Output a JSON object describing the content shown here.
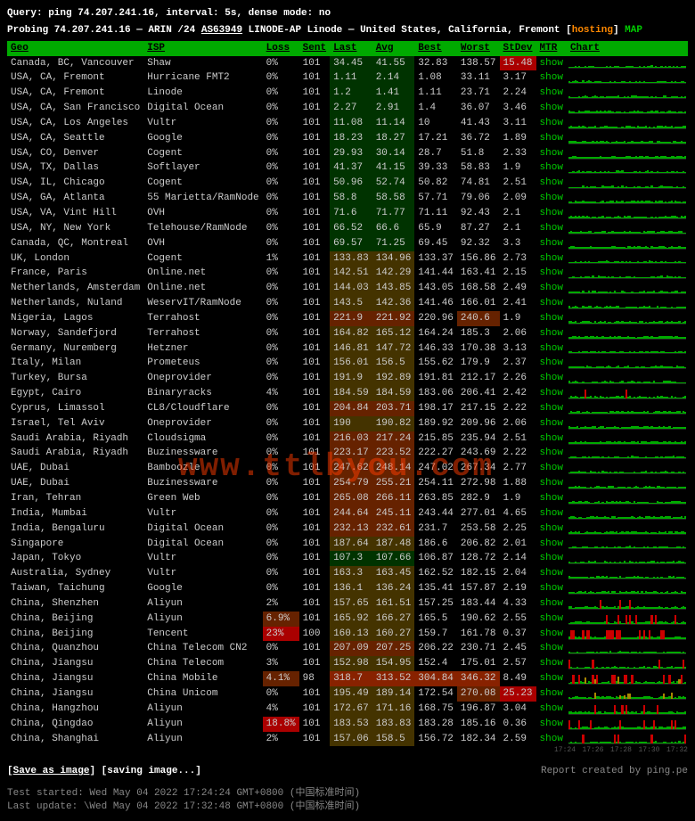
{
  "header": {
    "query_line": "Query: ping 74.207.241.16, interval: 5s, dense mode: no",
    "probe_prefix": "Probing 74.207.241.16 — ARIN /24 ",
    "asn": "AS63949",
    "probe_mid": " LINODE-AP Linode — United States, California, Fremont [",
    "hosting": "hosting",
    "probe_end": "] ",
    "map": "MAP"
  },
  "columns": [
    "Geo",
    "ISP",
    "Loss",
    "Sent",
    "Last",
    "Avg",
    "Best",
    "Worst",
    "StDev",
    "MTR",
    "Chart"
  ],
  "rows": [
    {
      "geo": "Canada, BC, Vancouver",
      "isp": "Shaw",
      "loss": "0%",
      "sent": "101",
      "last": "34.45",
      "avg": "41.55",
      "best": "32.83",
      "worst": "138.57",
      "stdev": "15.48",
      "lastcls": "bg-good",
      "stdevcls": "bg-crit",
      "chart": "g"
    },
    {
      "geo": "USA, CA, Fremont",
      "isp": "Hurricane FMT2",
      "loss": "0%",
      "sent": "101",
      "last": "1.11",
      "avg": "2.14",
      "best": "1.08",
      "worst": "33.11",
      "stdev": "3.17",
      "lastcls": "bg-good",
      "chart": "g"
    },
    {
      "geo": "USA, CA, Fremont",
      "isp": "Linode",
      "loss": "0%",
      "sent": "101",
      "last": "1.2",
      "avg": "1.41",
      "best": "1.11",
      "worst": "23.71",
      "stdev": "2.24",
      "lastcls": "bg-good",
      "chart": "g"
    },
    {
      "geo": "USA, CA, San Francisco",
      "isp": "Digital Ocean",
      "loss": "0%",
      "sent": "101",
      "last": "2.27",
      "avg": "2.91",
      "best": "1.4",
      "worst": "36.07",
      "stdev": "3.46",
      "lastcls": "bg-good",
      "chart": "g"
    },
    {
      "geo": "USA, CA, Los Angeles",
      "isp": "Vultr",
      "loss": "0%",
      "sent": "101",
      "last": "11.08",
      "avg": "11.14",
      "best": "10",
      "worst": "41.43",
      "stdev": "3.11",
      "lastcls": "bg-good",
      "chart": "g"
    },
    {
      "geo": "USA, CA, Seattle",
      "isp": "Google",
      "loss": "0%",
      "sent": "101",
      "last": "18.23",
      "avg": "18.27",
      "best": "17.21",
      "worst": "36.72",
      "stdev": "1.89",
      "lastcls": "bg-good",
      "chart": "g"
    },
    {
      "geo": "USA, CO, Denver",
      "isp": "Cogent",
      "loss": "0%",
      "sent": "101",
      "last": "29.93",
      "avg": "30.14",
      "best": "28.7",
      "worst": "51.8",
      "stdev": "2.33",
      "lastcls": "bg-good",
      "chart": "g"
    },
    {
      "geo": "USA, TX, Dallas",
      "isp": "Softlayer",
      "loss": "0%",
      "sent": "101",
      "last": "41.37",
      "avg": "41.15",
      "best": "39.33",
      "worst": "58.83",
      "stdev": "1.9",
      "lastcls": "bg-good",
      "chart": "g"
    },
    {
      "geo": "USA, IL, Chicago",
      "isp": "Cogent",
      "loss": "0%",
      "sent": "101",
      "last": "50.96",
      "avg": "52.74",
      "best": "50.82",
      "worst": "74.81",
      "stdev": "2.51",
      "lastcls": "bg-good",
      "chart": "g"
    },
    {
      "geo": "USA, GA, Atlanta",
      "isp": "55 Marietta/RamNode",
      "loss": "0%",
      "sent": "101",
      "last": "58.8",
      "avg": "58.58",
      "best": "57.71",
      "worst": "79.06",
      "stdev": "2.09",
      "lastcls": "bg-good",
      "chart": "g"
    },
    {
      "geo": "USA, VA, Vint Hill",
      "isp": "OVH",
      "loss": "0%",
      "sent": "101",
      "last": "71.6",
      "avg": "71.77",
      "best": "71.11",
      "worst": "92.43",
      "stdev": "2.1",
      "lastcls": "bg-good",
      "chart": "g"
    },
    {
      "geo": "USA, NY, New York",
      "isp": "Telehouse/RamNode",
      "loss": "0%",
      "sent": "101",
      "last": "66.52",
      "avg": "66.6",
      "best": "65.9",
      "worst": "87.27",
      "stdev": "2.1",
      "lastcls": "bg-good",
      "chart": "g"
    },
    {
      "geo": "Canada, QC, Montreal",
      "isp": "OVH",
      "loss": "0%",
      "sent": "101",
      "last": "69.57",
      "avg": "71.25",
      "best": "69.45",
      "worst": "92.32",
      "stdev": "3.3",
      "lastcls": "bg-good",
      "chart": "g"
    },
    {
      "geo": "UK, London",
      "isp": "Cogent",
      "loss": "1%",
      "sent": "101",
      "last": "133.83",
      "avg": "134.96",
      "best": "133.37",
      "worst": "156.86",
      "stdev": "2.73",
      "lastcls": "bg-med",
      "chart": "g"
    },
    {
      "geo": "France, Paris",
      "isp": "Online.net",
      "loss": "0%",
      "sent": "101",
      "last": "142.51",
      "avg": "142.29",
      "best": "141.44",
      "worst": "163.41",
      "stdev": "2.15",
      "lastcls": "bg-med",
      "chart": "g"
    },
    {
      "geo": "Netherlands, Amsterdam",
      "isp": "Online.net",
      "loss": "0%",
      "sent": "101",
      "last": "144.03",
      "avg": "143.85",
      "best": "143.05",
      "worst": "168.58",
      "stdev": "2.49",
      "lastcls": "bg-med",
      "chart": "g"
    },
    {
      "geo": "Netherlands, Nuland",
      "isp": "WeservIT/RamNode",
      "loss": "0%",
      "sent": "101",
      "last": "143.5",
      "avg": "142.36",
      "best": "141.46",
      "worst": "166.01",
      "stdev": "2.41",
      "lastcls": "bg-med",
      "chart": "g"
    },
    {
      "geo": "Nigeria, Lagos",
      "isp": "Terrahost",
      "loss": "0%",
      "sent": "101",
      "last": "221.9",
      "avg": "221.92",
      "best": "220.96",
      "worst": "240.6",
      "stdev": "1.9",
      "lastcls": "bg-bad",
      "worstcls": "bg-bad",
      "chart": "g"
    },
    {
      "geo": "Norway, Sandefjord",
      "isp": "Terrahost",
      "loss": "0%",
      "sent": "101",
      "last": "164.82",
      "avg": "165.12",
      "best": "164.24",
      "worst": "185.3",
      "stdev": "2.06",
      "lastcls": "bg-med",
      "chart": "g"
    },
    {
      "geo": "Germany, Nuremberg",
      "isp": "Hetzner",
      "loss": "0%",
      "sent": "101",
      "last": "146.81",
      "avg": "147.72",
      "best": "146.33",
      "worst": "170.38",
      "stdev": "3.13",
      "lastcls": "bg-med",
      "chart": "g"
    },
    {
      "geo": "Italy, Milan",
      "isp": "Prometeus",
      "loss": "0%",
      "sent": "101",
      "last": "156.01",
      "avg": "156.5",
      "best": "155.62",
      "worst": "179.9",
      "stdev": "2.37",
      "lastcls": "bg-med",
      "chart": "g"
    },
    {
      "geo": "Turkey, Bursa",
      "isp": "Oneprovider",
      "loss": "0%",
      "sent": "101",
      "last": "191.9",
      "avg": "192.89",
      "best": "191.81",
      "worst": "212.17",
      "stdev": "2.26",
      "lastcls": "bg-med",
      "chart": "g"
    },
    {
      "geo": "Egypt, Cairo",
      "isp": "Binaryracks",
      "loss": "4%",
      "sent": "101",
      "last": "184.59",
      "avg": "184.59",
      "best": "183.06",
      "worst": "206.41",
      "stdev": "2.42",
      "lastcls": "bg-med",
      "chart": "gr"
    },
    {
      "geo": "Cyprus, Limassol",
      "isp": "CL8/Cloudflare",
      "loss": "0%",
      "sent": "101",
      "last": "204.84",
      "avg": "203.71",
      "best": "198.17",
      "worst": "217.15",
      "stdev": "2.22",
      "lastcls": "bg-bad",
      "chart": "g"
    },
    {
      "geo": "Israel, Tel Aviv",
      "isp": "Oneprovider",
      "loss": "0%",
      "sent": "101",
      "last": "190",
      "avg": "190.82",
      "best": "189.92",
      "worst": "209.96",
      "stdev": "2.06",
      "lastcls": "bg-med",
      "chart": "g"
    },
    {
      "geo": "Saudi Arabia, Riyadh",
      "isp": "Cloudsigma",
      "loss": "0%",
      "sent": "101",
      "last": "216.03",
      "avg": "217.24",
      "best": "215.85",
      "worst": "235.94",
      "stdev": "2.51",
      "lastcls": "bg-bad",
      "chart": "g"
    },
    {
      "geo": "Saudi Arabia, Riyadh",
      "isp": "Buzinessware",
      "loss": "0%",
      "sent": "101",
      "last": "223.17",
      "avg": "223.52",
      "best": "222.27",
      "worst": "243.69",
      "stdev": "2.22",
      "lastcls": "bg-bad",
      "chart": "g"
    },
    {
      "geo": "UAE, Dubai",
      "isp": "Bamboozle",
      "loss": "0%",
      "sent": "101",
      "last": "247.62",
      "avg": "248.14",
      "best": "247.02",
      "worst": "267.34",
      "stdev": "2.77",
      "lastcls": "bg-bad",
      "chart": "g"
    },
    {
      "geo": "UAE, Dubai",
      "isp": "Buzinessware",
      "loss": "0%",
      "sent": "101",
      "last": "254.79",
      "avg": "255.21",
      "best": "254.11",
      "worst": "272.98",
      "stdev": "1.88",
      "lastcls": "bg-bad",
      "chart": "g"
    },
    {
      "geo": "Iran, Tehran",
      "isp": "Green Web",
      "loss": "0%",
      "sent": "101",
      "last": "265.08",
      "avg": "266.11",
      "best": "263.85",
      "worst": "282.9",
      "stdev": "1.9",
      "lastcls": "bg-bad",
      "chart": "g"
    },
    {
      "geo": "India, Mumbai",
      "isp": "Vultr",
      "loss": "0%",
      "sent": "101",
      "last": "244.64",
      "avg": "245.11",
      "best": "243.44",
      "worst": "277.01",
      "stdev": "4.65",
      "lastcls": "bg-bad",
      "chart": "g"
    },
    {
      "geo": "India, Bengaluru",
      "isp": "Digital Ocean",
      "loss": "0%",
      "sent": "101",
      "last": "232.13",
      "avg": "232.61",
      "best": "231.7",
      "worst": "253.58",
      "stdev": "2.25",
      "lastcls": "bg-bad",
      "chart": "g"
    },
    {
      "geo": "Singapore",
      "isp": "Digital Ocean",
      "loss": "0%",
      "sent": "101",
      "last": "187.64",
      "avg": "187.48",
      "best": "186.6",
      "worst": "206.82",
      "stdev": "2.01",
      "lastcls": "bg-med",
      "chart": "g"
    },
    {
      "geo": "Japan, Tokyo",
      "isp": "Vultr",
      "loss": "0%",
      "sent": "101",
      "last": "107.3",
      "avg": "107.66",
      "best": "106.87",
      "worst": "128.72",
      "stdev": "2.14",
      "lastcls": "bg-good",
      "chart": "g"
    },
    {
      "geo": "Australia, Sydney",
      "isp": "Vultr",
      "loss": "0%",
      "sent": "101",
      "last": "163.3",
      "avg": "163.45",
      "best": "162.52",
      "worst": "182.15",
      "stdev": "2.04",
      "lastcls": "bg-med",
      "chart": "g"
    },
    {
      "geo": "Taiwan, Taichung",
      "isp": "Google",
      "loss": "0%",
      "sent": "101",
      "last": "136.1",
      "avg": "136.24",
      "best": "135.41",
      "worst": "157.87",
      "stdev": "2.19",
      "lastcls": "bg-med",
      "chart": "g"
    },
    {
      "geo": "China, Shenzhen",
      "isp": "Aliyun",
      "loss": "2%",
      "sent": "101",
      "last": "157.65",
      "avg": "161.51",
      "best": "157.25",
      "worst": "183.44",
      "stdev": "4.33",
      "lastcls": "bg-med",
      "chart": "gr"
    },
    {
      "geo": "China, Beijing",
      "isp": "Aliyun",
      "loss": "6.9%",
      "sent": "101",
      "last": "165.92",
      "avg": "166.27",
      "best": "165.5",
      "worst": "190.62",
      "stdev": "2.55",
      "lastcls": "bg-med",
      "losscls": "bg-bad",
      "chart": "grr"
    },
    {
      "geo": "China, Beijing",
      "isp": "Tencent",
      "loss": "23%",
      "sent": "100",
      "last": "160.13",
      "avg": "160.27",
      "best": "159.7",
      "worst": "161.78",
      "stdev": "0.37",
      "lastcls": "bg-med",
      "losscls": "bg-crit",
      "chart": "grrr"
    },
    {
      "geo": "China, Quanzhou",
      "isp": "China Telecom CN2",
      "loss": "0%",
      "sent": "101",
      "last": "207.09",
      "avg": "207.25",
      "best": "206.22",
      "worst": "230.71",
      "stdev": "2.45",
      "lastcls": "bg-bad",
      "chart": "g"
    },
    {
      "geo": "China, Jiangsu",
      "isp": "China Telecom",
      "loss": "3%",
      "sent": "101",
      "last": "152.98",
      "avg": "154.95",
      "best": "152.4",
      "worst": "175.01",
      "stdev": "2.57",
      "lastcls": "bg-med",
      "chart": "gr"
    },
    {
      "geo": "China, Jiangsu",
      "isp": "China Mobile",
      "loss": "4.1%",
      "sent": "98",
      "last": "318.7",
      "avg": "313.52",
      "best": "304.84",
      "worst": "346.32",
      "stdev": "8.49",
      "lastcls": "bg-vbad",
      "avgcls": "bg-vbad",
      "bestcls": "bg-vbad",
      "worstcls": "bg-vbad",
      "losscls": "bg-bad",
      "chart": "yrr"
    },
    {
      "geo": "China, Jiangsu",
      "isp": "China Unicom",
      "loss": "0%",
      "sent": "101",
      "last": "195.49",
      "avg": "189.14",
      "best": "172.54",
      "worst": "270.08",
      "stdev": "25.23",
      "lastcls": "bg-med",
      "worstcls": "bg-bad",
      "stdevcls": "bg-crit",
      "chart": "gy"
    },
    {
      "geo": "China, Hangzhou",
      "isp": "Aliyun",
      "loss": "4%",
      "sent": "101",
      "last": "172.67",
      "avg": "171.16",
      "best": "168.75",
      "worst": "196.87",
      "stdev": "3.04",
      "lastcls": "bg-med",
      "chart": "gr"
    },
    {
      "geo": "China, Qingdao",
      "isp": "Aliyun",
      "loss": "18.8%",
      "sent": "101",
      "last": "183.53",
      "avg": "183.83",
      "best": "183.28",
      "worst": "185.16",
      "stdev": "0.36",
      "lastcls": "bg-med",
      "losscls": "bg-crit",
      "chart": "grrr"
    },
    {
      "geo": "China, Shanghai",
      "isp": "Aliyun",
      "loss": "2%",
      "sent": "101",
      "last": "157.06",
      "avg": "158.5",
      "best": "156.72",
      "worst": "182.34",
      "stdev": "2.59",
      "lastcls": "bg-med",
      "chart": "gr"
    }
  ],
  "footer": {
    "save": "Save as image",
    "saving": "[saving image...]",
    "credit": "Report created by ping.pe",
    "started": "Test started: Wed May 04 2022 17:24:24 GMT+0800 (中国标准时间)",
    "updated": "Last update: \\Wed May 04 2022 17:32:48 GMT+0800 (中国标准时间)"
  },
  "time_axis": [
    "17:24",
    "17:26",
    "17:28",
    "17:30",
    "17:32"
  ],
  "mtr_label": "show"
}
